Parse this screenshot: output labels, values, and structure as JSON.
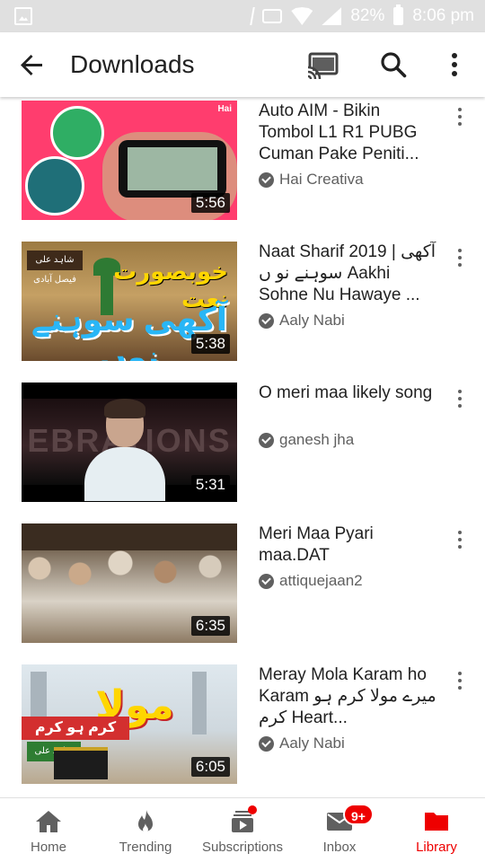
{
  "status_bar": {
    "battery": "82%",
    "time": "8:06 pm"
  },
  "header": {
    "title": "Downloads"
  },
  "videos": [
    {
      "title": "Auto AIM - Bikin Tombol L1 R1 PUBG Cuman Pake Peniti...",
      "channel": "Hai Creativa",
      "duration": "5:56",
      "thumb_tag": "Hai"
    },
    {
      "title": "Naat Sharif 2019 | آکھی سوہنے نو ں Aakhi Sohne Nu Hawaye ...",
      "channel": "Aaly Nabi",
      "duration": "5:38",
      "thumb_text_1": "خوبصورت نعت",
      "thumb_text_2": "آکھی سوہنے نوں",
      "thumb_text_3": "شاہد علی فیصل آبادی"
    },
    {
      "title": "O meri maa likely song",
      "channel": "ganesh jha",
      "duration": "5:31",
      "thumb_word": "EBRATIONS"
    },
    {
      "title": "Meri Maa Pyari maa.DAT",
      "channel": "attiquejaan2",
      "duration": "6:35"
    },
    {
      "title": "Meray Mola Karam ho Karam میرے مولا کرم ہو کرم Heart...",
      "channel": "Aaly Nabi",
      "duration": "6:05",
      "thumb_text_1": "مولا",
      "thumb_text_2": "کرم ہو کرم",
      "thumb_text_3": "شاہد علی"
    }
  ],
  "bottom_nav": [
    {
      "label": "Home",
      "icon": "home-icon"
    },
    {
      "label": "Trending",
      "icon": "flame-icon"
    },
    {
      "label": "Subscriptions",
      "icon": "subscriptions-icon"
    },
    {
      "label": "Inbox",
      "icon": "mail-icon",
      "badge": "9+"
    },
    {
      "label": "Library",
      "icon": "folder-icon",
      "active": true
    }
  ],
  "colors": {
    "accent": "#ee0000",
    "text_secondary": "#606060"
  }
}
